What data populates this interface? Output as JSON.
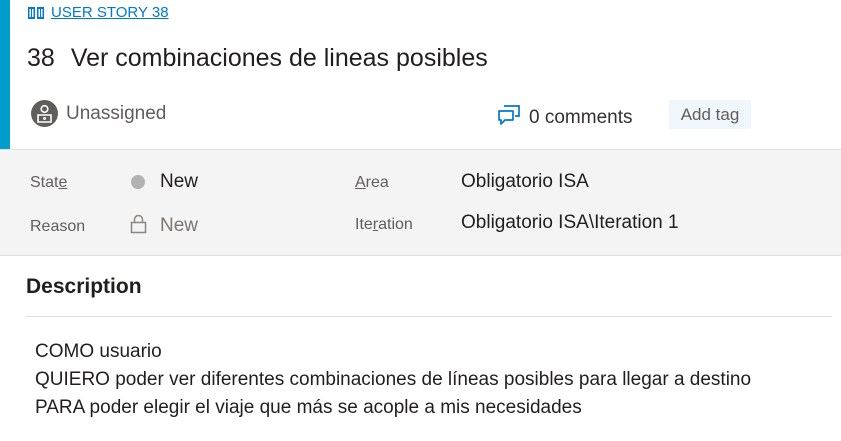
{
  "work_item": {
    "type_label": "USER STORY 38",
    "id": "38",
    "title": "Ver combinaciones de lineas posibles",
    "assignee": "Unassigned",
    "comments": "0 comments",
    "add_tag": "Add tag"
  },
  "fields": {
    "state_label_prefix": "Stat",
    "state_label_accel": "e",
    "state_value": "New",
    "reason_label": "Reason",
    "reason_value": "New",
    "area_label_accel": "A",
    "area_label_rest": "rea",
    "area_value": "Obligatorio ISA",
    "iteration_label_prefix": "Ite",
    "iteration_label_accel": "r",
    "iteration_label_rest": "ation",
    "iteration_value": "Obligatorio ISA\\Iteration 1"
  },
  "description": {
    "heading": "Description",
    "lines": [
      "COMO usuario",
      "QUIERO poder ver diferentes combinaciones de líneas posibles para llegar a destino",
      "PARA poder elegir el viaje que más se acople a mis necesidades"
    ]
  },
  "colors": {
    "accent": "#009ccc",
    "link": "#0078d4",
    "state_new_dot": "#b2b2b2"
  }
}
